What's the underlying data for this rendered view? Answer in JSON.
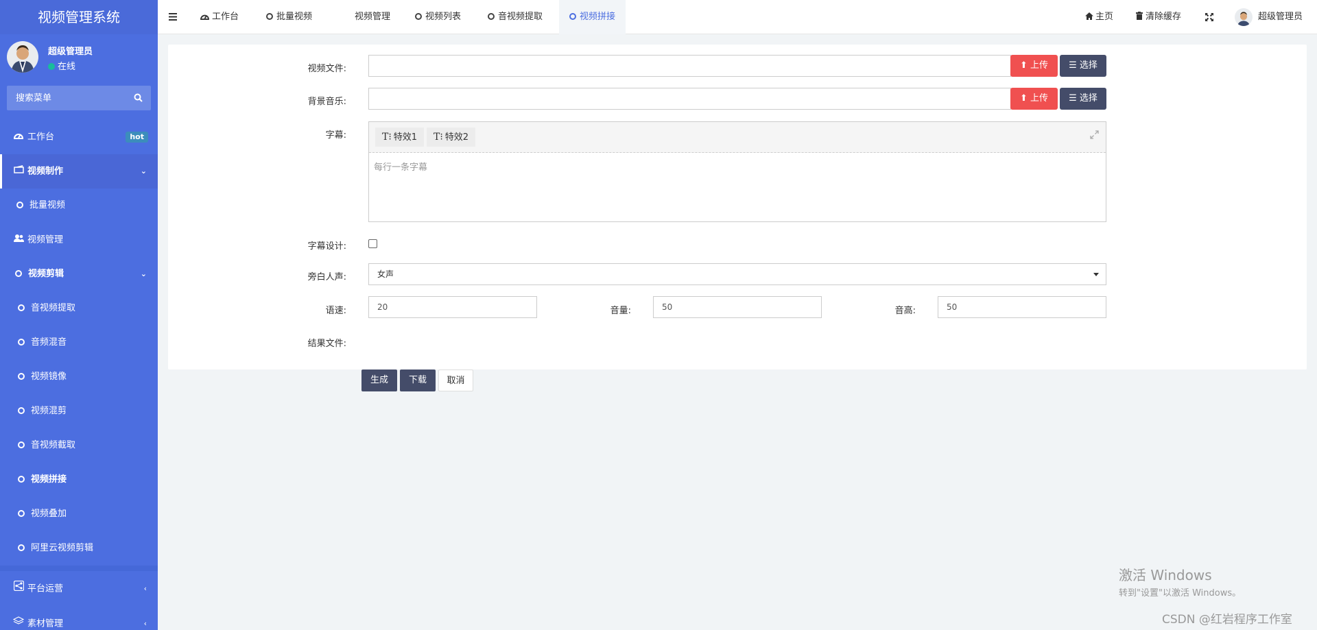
{
  "app": {
    "title": "视频管理系统"
  },
  "user": {
    "name": "超级管理员",
    "status": "在线"
  },
  "search": {
    "placeholder": "搜索菜单"
  },
  "sidebar": {
    "items": [
      {
        "label": "工作台",
        "badge": "hot"
      },
      {
        "label": "视频制作"
      },
      {
        "label": "批量视频"
      },
      {
        "label": "视频管理"
      },
      {
        "label": "视频剪辑"
      },
      {
        "label": "音视频提取"
      },
      {
        "label": "音频混音"
      },
      {
        "label": "视频镜像"
      },
      {
        "label": "视频混剪"
      },
      {
        "label": "音视频截取"
      },
      {
        "label": "视频拼接"
      },
      {
        "label": "视频叠加"
      },
      {
        "label": "阿里云视频剪辑"
      },
      {
        "label": "平台运营"
      },
      {
        "label": "素材管理"
      }
    ]
  },
  "topbar": {
    "tabs": [
      {
        "label": "工作台"
      },
      {
        "label": "批量视频"
      },
      {
        "label": "视频管理"
      },
      {
        "label": "视频列表"
      },
      {
        "label": "音视频提取"
      },
      {
        "label": "视频拼接"
      }
    ],
    "home": "主页",
    "clear_cache": "清除缓存",
    "user": "超级管理员"
  },
  "form": {
    "video_file_label": "视频文件:",
    "bg_music_label": "背景音乐:",
    "upload_label": "上传",
    "select_label": "选择",
    "subtitle_label": "字幕:",
    "effect1": "特效1",
    "effect2": "特效2",
    "subtitle_placeholder": "每行一条字幕",
    "subtitle_design_label": "字幕设计:",
    "narrator_label": "旁白人声:",
    "narrator_value": "女声",
    "speed_label": "语速:",
    "speed_value": "20",
    "volume_label": "音量:",
    "volume_value": "50",
    "pitch_label": "音高:",
    "pitch_value": "50",
    "result_label": "结果文件:"
  },
  "actions": {
    "generate": "生成",
    "download": "下载",
    "cancel": "取消"
  },
  "watermark": {
    "line1": "激活 Windows",
    "line2": "转到\"设置\"以激活 Windows。"
  },
  "credit": "CSDN @红岩程序工作室"
}
